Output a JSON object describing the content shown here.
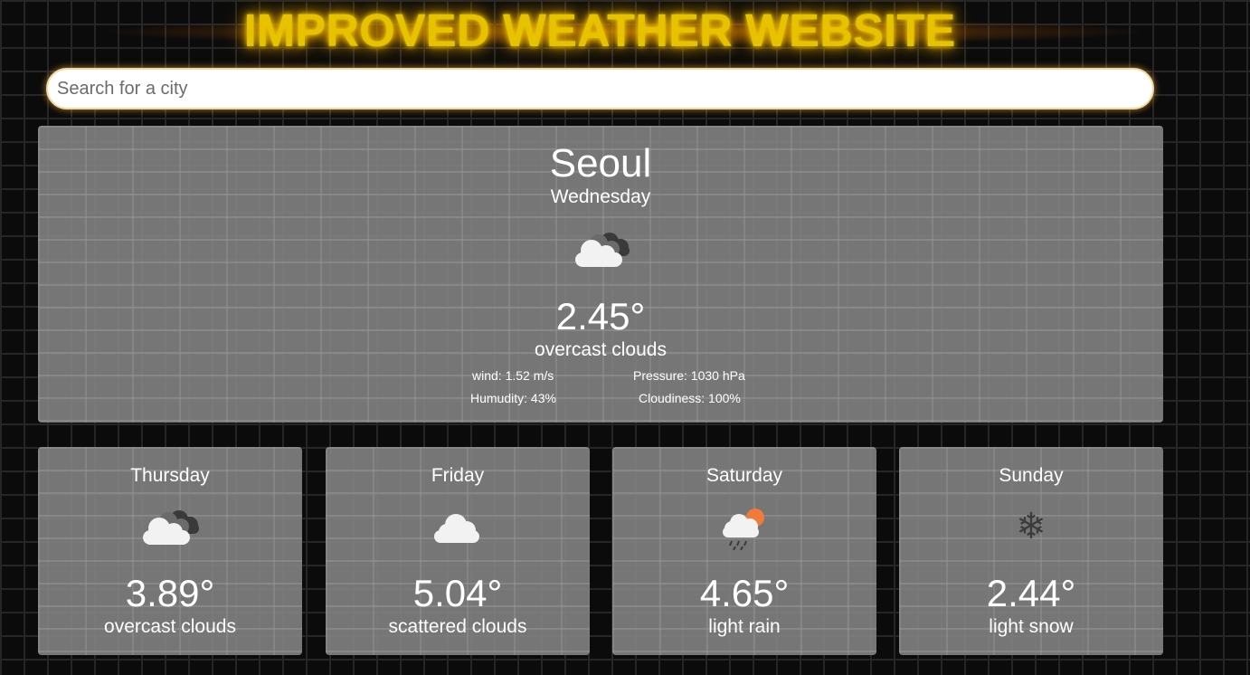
{
  "header": {
    "title": "IMPROVED WEATHER WEBSITE"
  },
  "search": {
    "placeholder": "Search for a city",
    "value": ""
  },
  "current": {
    "city": "Seoul",
    "day": "Wednesday",
    "icon": "overcast-clouds-icon",
    "temperature": "2.45°",
    "description": "overcast clouds",
    "wind": "wind: 1.52 m/s",
    "pressure": "Pressure: 1030 hPa",
    "humidity": "Humudity: 43%",
    "cloudiness": "Cloudiness: 100%"
  },
  "forecast": [
    {
      "day": "Thursday",
      "icon": "overcast-clouds-icon",
      "temperature": "3.89°",
      "description": "overcast clouds"
    },
    {
      "day": "Friday",
      "icon": "scattered-clouds-icon",
      "temperature": "5.04°",
      "description": "scattered clouds"
    },
    {
      "day": "Saturday",
      "icon": "light-rain-icon",
      "temperature": "4.65°",
      "description": "light rain"
    },
    {
      "day": "Sunday",
      "icon": "light-snow-icon",
      "temperature": "2.44°",
      "description": "light snow",
      "glyph": "❄"
    }
  ],
  "colors": {
    "title": "#e6c200",
    "panel": "#808080",
    "sun": "#f07a3a"
  }
}
